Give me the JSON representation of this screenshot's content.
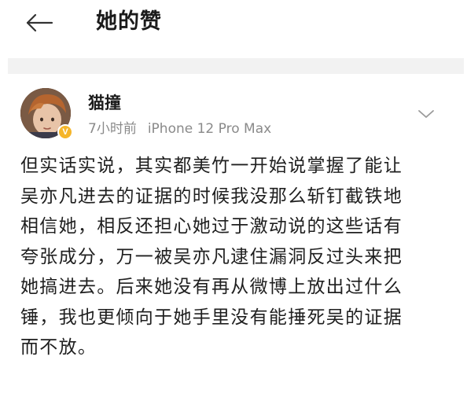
{
  "header": {
    "title": "她的赞",
    "back_icon": "arrow-left-icon"
  },
  "post": {
    "author": "猫撞",
    "time": "7小时前",
    "device": "iPhone 12 Pro Max",
    "badge_icon": "vip-badge-icon",
    "badge_text": "V",
    "menu_icon": "chevron-down-icon",
    "content_lines": [
      "但实话实说，其实都美竹一开始说掌握了能让",
      "吴亦凡进去的证据的时候我没那么斩钉截铁地",
      "相信她，相反还担心她过于激动说的这些话有",
      "夸张成分，万一被吴亦凡逮住漏洞反过头来把",
      "她搞进去。后来她没有再从微博上放出过什么",
      "锤，我也更倾向于她手里没有能捶死吴的证据",
      "而不放。"
    ]
  },
  "colors": {
    "background": "#ffffff",
    "divider": "#f2f2f2",
    "meta_text": "#8a8a8a",
    "badge": "#f5b52a"
  }
}
